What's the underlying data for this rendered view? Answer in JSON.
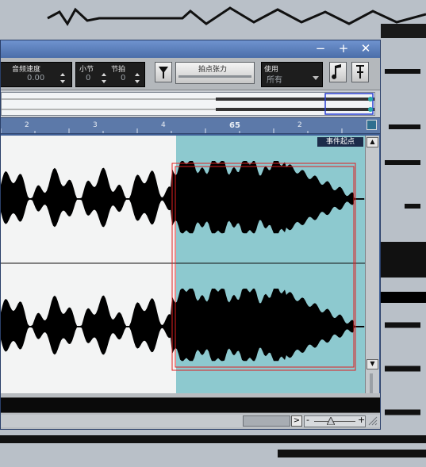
{
  "window": {
    "minimize_glyph": "−",
    "maximize_glyph": "+",
    "close_glyph": "✕"
  },
  "toolbar": {
    "audio_speed_label": "音频速度",
    "audio_speed_value": "0.00",
    "bars_label": "小节",
    "beats_label": "节拍",
    "bars_value": "0",
    "beats_value": "0",
    "hitpoint_label": "拍点张力",
    "use_label": "使用",
    "use_value": "所有",
    "funnel_icon": "funnel-icon",
    "note_icon": "note-icon",
    "pin_icon": "pin-icon"
  },
  "ruler": {
    "ticks": [
      "2",
      "3",
      "4",
      "65",
      "2"
    ]
  },
  "waveform": {
    "event_start_label": "事件起点",
    "selection_color": "#8dc9cf",
    "region_color": "#e02020"
  },
  "scroll": {
    "right_arrow": ">",
    "zoom_minus": "-",
    "zoom_plus": "+"
  }
}
